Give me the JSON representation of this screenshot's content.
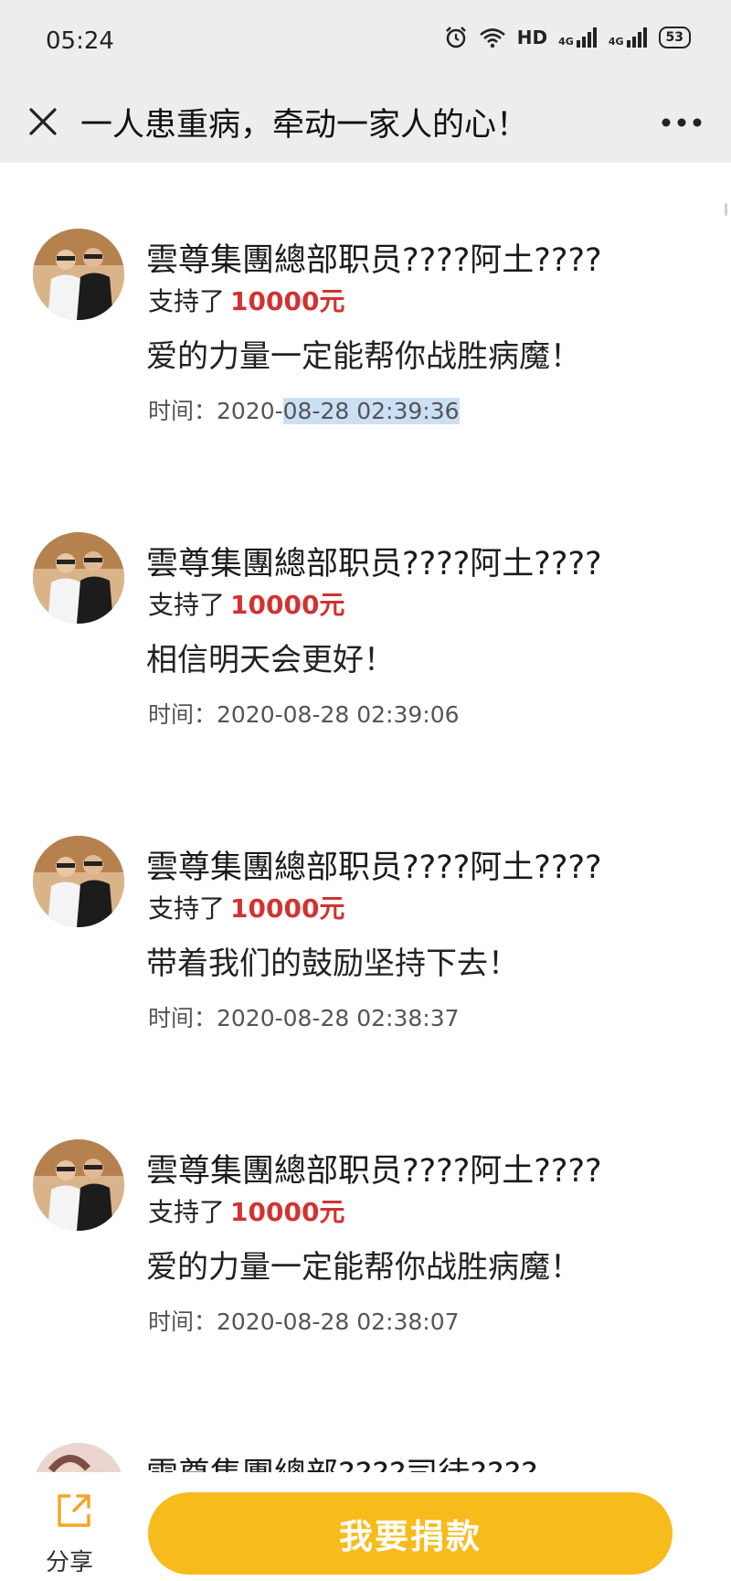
{
  "status_bar": {
    "time": "05:24",
    "network_label": "HD",
    "signal1_label": "4G",
    "signal2_label": "4G",
    "battery": "53"
  },
  "header": {
    "title": "一人患重病，牵动一家人的心！"
  },
  "donations": [
    {
      "donor_name": "雲尊集團總部职员????阿土????",
      "support_prefix": "支持了",
      "amount": "10000元",
      "message": "爱的力量一定能帮你战胜病魔！",
      "time_prefix": "时间：2020-",
      "time_highlight": "08-28 02:39:36"
    },
    {
      "donor_name": "雲尊集團總部职员????阿土????",
      "support_prefix": "支持了",
      "amount": "10000元",
      "message": "相信明天会更好！",
      "time": "时间：2020-08-28 02:39:06"
    },
    {
      "donor_name": "雲尊集團總部职员????阿土????",
      "support_prefix": "支持了",
      "amount": "10000元",
      "message": "带着我们的鼓励坚持下去！",
      "time": "时间：2020-08-28 02:38:37"
    },
    {
      "donor_name": "雲尊集團總部职员????阿土????",
      "support_prefix": "支持了",
      "amount": "10000元",
      "message": "爱的力量一定能帮你战胜病魔！",
      "time": "时间：2020-08-28 02:38:07"
    },
    {
      "donor_name": "雲尊集團總部????司徒????"
    }
  ],
  "bottom_bar": {
    "share_label": "分享",
    "donate_label": "我要捐款"
  },
  "colors": {
    "amount": "#d23232",
    "donate_button": "#f7bb1b",
    "header_bg": "#ededed",
    "highlight": "#cce0f5"
  }
}
